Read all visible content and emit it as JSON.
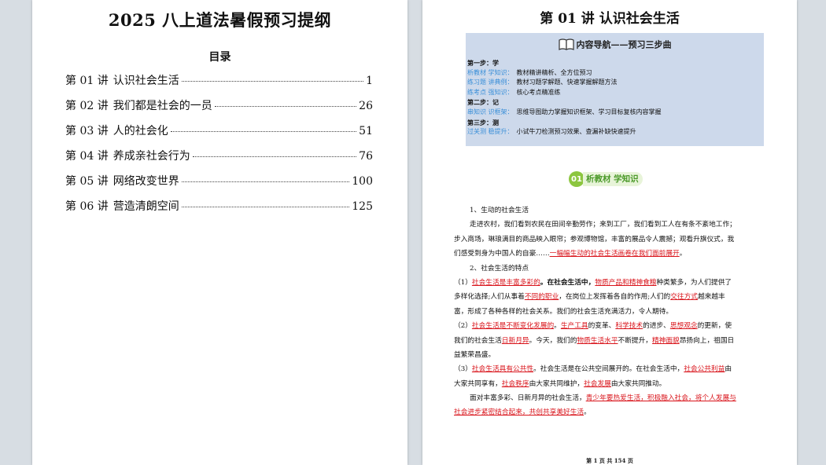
{
  "left": {
    "title": "2025 八上道法暑假预习提纲",
    "toc_heading": "目录",
    "toc": [
      {
        "num": "第 01 讲",
        "label": "认识社会生活",
        "page": "1"
      },
      {
        "num": "第 02 讲",
        "label": "我们都是社会的一员",
        "page": "26"
      },
      {
        "num": "第 03 讲",
        "label": "人的社会化",
        "page": "51"
      },
      {
        "num": "第 04 讲",
        "label": "养成亲社会行为",
        "page": "76"
      },
      {
        "num": "第 05 讲",
        "label": "网络改变世界",
        "page": "100"
      },
      {
        "num": "第 06 讲",
        "label": "营造清朗空间",
        "page": "125"
      }
    ]
  },
  "right": {
    "lesson_title": "第 01 讲  认识社会生活",
    "nav": {
      "header": "内容导航——预习三步曲",
      "lines": [
        {
          "tag": "",
          "text": "第一步：学",
          "step": true
        },
        {
          "tag": "析教材 学知识：",
          "text": "教材精讲精析、全方位预习",
          "step": false
        },
        {
          "tag": "练习题 讲典例：",
          "text": "教材习题学解题、快速掌握解题方法",
          "step": false
        },
        {
          "tag": "练考点 强知识：",
          "text": "核心考点精准练",
          "step": false
        },
        {
          "tag": "",
          "text": "第二步：记",
          "step": true
        },
        {
          "tag": "串知识 识框架：",
          "text": "思维导图助力掌握知识框架、学习目标复核内容掌握",
          "step": false
        },
        {
          "tag": "",
          "text": "第三步：测",
          "step": true
        },
        {
          "tag": "过关测 稳提升：",
          "text": "小试牛刀检测预习效果、查漏补缺快速提升",
          "step": false
        }
      ]
    },
    "badge": {
      "num": "01",
      "label": "析教材 学知识"
    },
    "content": {
      "h1": "1、生动的社会生活",
      "p1": [
        "走进农村，我们看到农民在田间辛勤劳作；来到工厂，我们看到工人在有条不紊地工作；",
        "步入商场，琳琅满目的商品映入眼帘；参观博物馆，丰富的展品令人震撼；观看升旗仪式，我",
        "们感受到身为中国人的自豪……",
        "一幅幅生动的社会生活画卷在我们面前展开"
      ],
      "h2": "2、社会生活的特点",
      "s1": {
        "n": "（1）",
        "a": "社会生活是丰富多彩的",
        "b": "。在社会生活中，",
        "c": "物质产品和精神食粮",
        "d": "种类繁多，为人们提供了",
        "e": "多样化选择;人们从事着",
        "f": "不同的职业",
        "g": "，在岗位上发挥着各自的作用;人们的",
        "h": "交往方式",
        "i": "越来越丰",
        "j": "富，形成了各种各样的社会关系。我们的社会生活充满活力，令人期待。"
      },
      "s2": {
        "n": "（2）",
        "a": "社会生活是不断变化发展的",
        "b": "。",
        "c": "生产工具",
        "d": "的变革、",
        "e": "科学技术",
        "f": "的进步、",
        "g": "思想观念",
        "h": "的更新，使",
        "i": "我们的社会生活",
        "j": "日新月异",
        "k": "。今天，我们的",
        "l": "物质生活水平",
        "m": "不断提升，",
        "o": "精神面貌",
        "p": "昂扬向上，祖国日",
        "q": "益繁荣昌盛。"
      },
      "s3": {
        "n": "（3）",
        "a": "社会生活具有公共性",
        "b": "。社会生活是在公共空间展开的。在社会生活中，",
        "c": "社会公共利益",
        "d": "由",
        "e": "大家共同享有，",
        "f": "社会秩序",
        "g": "由大家共同维护，",
        "h": "社会发展",
        "i": "由大家共同推动。"
      },
      "p_end": {
        "a": "面对丰富多彩、日新月异的社会生活，",
        "b": "青少年要热爱生活，积极融入社会，将个人发展与",
        "c": "社会进步紧密结合起来，共创共享美好生活"
      }
    },
    "footer": "第 1 页 共 154 页"
  }
}
